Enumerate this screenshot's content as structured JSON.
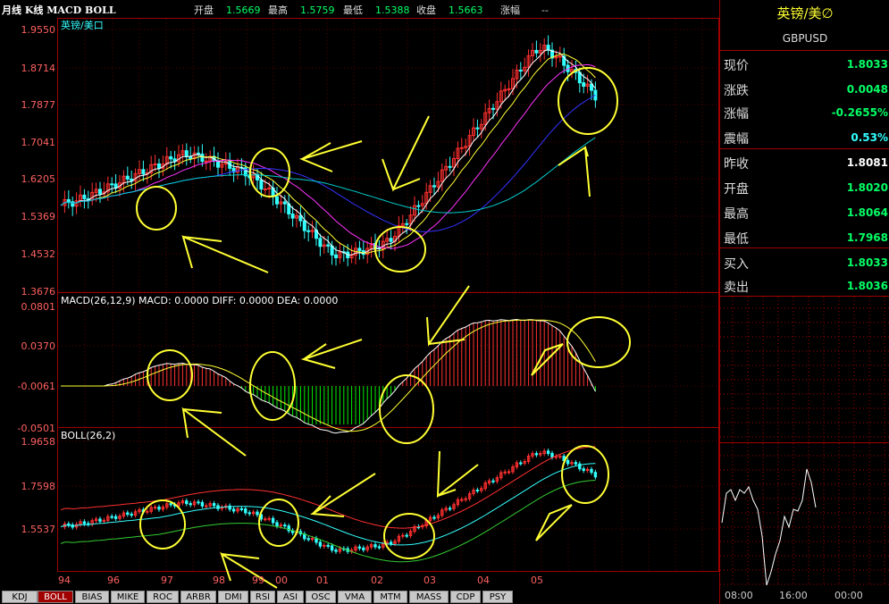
{
  "header": {
    "title": "月线 K线 MACD BOLL",
    "stats": [
      {
        "label": "开盘",
        "value": "1.5669"
      },
      {
        "label": "最高",
        "value": "1.5759"
      },
      {
        "label": "最低",
        "value": "1.5388"
      },
      {
        "label": "收盘",
        "value": "1.5663"
      },
      {
        "label": "涨幅",
        "value": "--"
      }
    ]
  },
  "panels": {
    "price": {
      "title": "英镑/美口",
      "y_ticks": [
        "1.9550",
        "1.8714",
        "1.7877",
        "1.7041",
        "1.6205",
        "1.5369",
        "1.4532",
        "1.3676"
      ]
    },
    "macd": {
      "title": "MACD(26,12,9) MACD: 0.0000  DIFF: 0.0000  DEA: 0.0000",
      "y_ticks": [
        "0.0801",
        "0.0370",
        "-0.0061",
        "-0.0501"
      ]
    },
    "boll": {
      "title": "BOLL(26,2)",
      "y_ticks": [
        "1.9658",
        "1.7598",
        "1.5537"
      ]
    }
  },
  "x_axis": [
    "94",
    "96",
    "97",
    "98",
    "99",
    "00",
    "01",
    "02",
    "03",
    "04",
    "05"
  ],
  "tabs": [
    "KDJ",
    "BOLL",
    "BIAS",
    "MIKE",
    "ROC",
    "ARBR",
    "DMI",
    "RSI",
    "ASI",
    "OSC",
    "VMA",
    "MTM",
    "MASS",
    "CDP",
    "PSY"
  ],
  "active_tab": "BOLL",
  "quote": {
    "name": "英镑/美∅",
    "code": "GBPUSD",
    "rows": [
      {
        "label": "现价",
        "value": "1.8033",
        "color": "#00ff66"
      },
      {
        "label": "涨跌",
        "value": "0.0048",
        "color": "#00ff66"
      },
      {
        "label": "涨幅",
        "value": "-0.2655%",
        "color": "#00ff66"
      },
      {
        "label": "震幅",
        "value": "0.53%",
        "color": "#33ffff"
      },
      {
        "label": "昨收",
        "value": "1.8081",
        "color": "#ffffff"
      },
      {
        "label": "开盘",
        "value": "1.8020",
        "color": "#00ff66"
      },
      {
        "label": "最高",
        "value": "1.8064",
        "color": "#00ff66"
      },
      {
        "label": "最低",
        "value": "1.7968",
        "color": "#00ff66"
      },
      {
        "label": "买入",
        "value": "1.8033",
        "color": "#00ff66"
      },
      {
        "label": "卖出",
        "value": "1.8036",
        "color": "#00ff66"
      }
    ],
    "intraday_times": [
      "08:00",
      "16:00",
      "00:00"
    ]
  }
}
